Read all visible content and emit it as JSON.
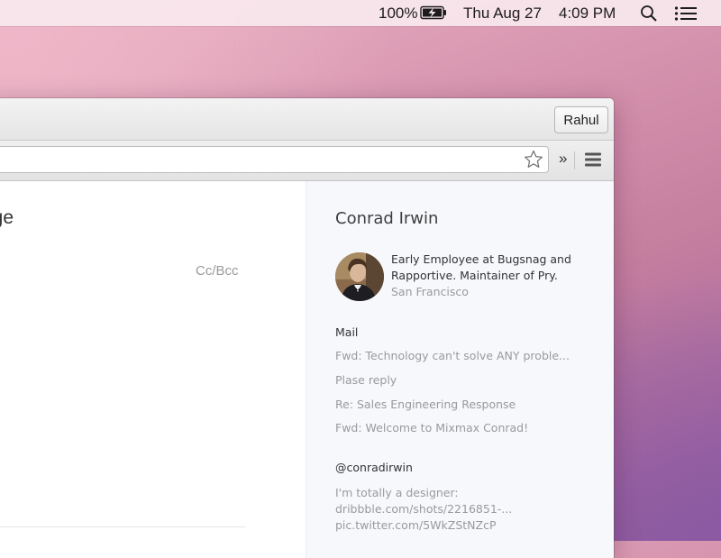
{
  "menubar": {
    "battery_percent": "100%",
    "date": "Thu Aug 27",
    "time": "4:09 PM",
    "icons": [
      "battery-charging-icon",
      "spotlight-search-icon",
      "notification-center-icon"
    ]
  },
  "browser": {
    "profile_name": "Rahul",
    "omnibox_value": "",
    "icons": [
      "bookmark-star-icon",
      "extensions-chevron-icon",
      "chrome-menu-icon"
    ]
  },
  "compose": {
    "title_fragment": "age",
    "cc_bcc_label": "Cc/Bcc"
  },
  "sidebar": {
    "contact_name": "Conrad Irwin",
    "bio": "Early Employee at Bugsnag and Rapportive. Maintainer of Pry.",
    "location": "San Francisco",
    "mail_heading": "Mail",
    "mail_items": [
      "Fwd: Technology can't solve ANY proble...",
      "Plase reply",
      "Re: Sales Engineering Response",
      "Fwd: Welcome to Mixmax Conrad!"
    ],
    "twitter_handle": "@conradirwin",
    "tweet_lines": [
      "I'm totally a designer:",
      "dribbble.com/shots/2216851-...",
      "pic.twitter.com/5WkZStNZcP"
    ]
  },
  "colors": {
    "sidebar_bg": "#f6f8fc",
    "muted_text": "#9a9a9a",
    "dark_text": "#333333"
  }
}
